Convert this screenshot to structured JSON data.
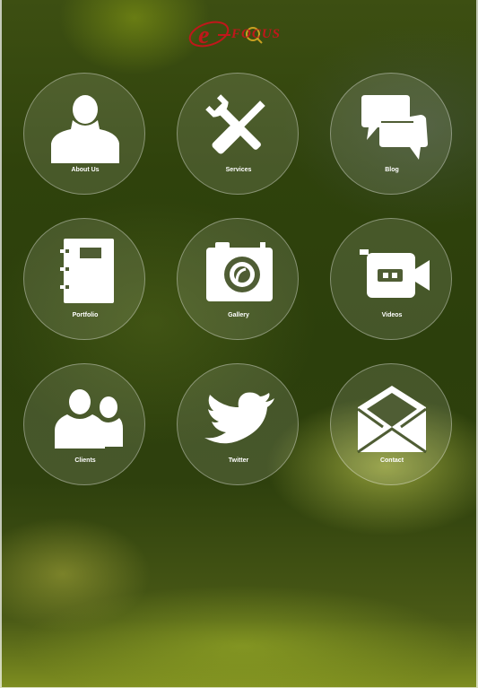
{
  "brand": {
    "logo_text": "FOCUS",
    "logo_color": "#c0171b"
  },
  "tiles": [
    {
      "label": "About Us",
      "icon": "person-icon"
    },
    {
      "label": "Services",
      "icon": "tools-icon"
    },
    {
      "label": "Blog",
      "icon": "chat-bubbles-icon"
    },
    {
      "label": "Portfolio",
      "icon": "notebook-icon"
    },
    {
      "label": "Gallery",
      "icon": "camera-icon"
    },
    {
      "label": "Videos",
      "icon": "video-camera-icon"
    },
    {
      "label": "Clients",
      "icon": "group-icon"
    },
    {
      "label": "Twitter",
      "icon": "twitter-bird-icon"
    },
    {
      "label": "Contact",
      "icon": "envelope-icon"
    }
  ],
  "colors": {
    "icon": "#ffffff",
    "tile_border": "rgba(255,255,255,0.35)"
  }
}
